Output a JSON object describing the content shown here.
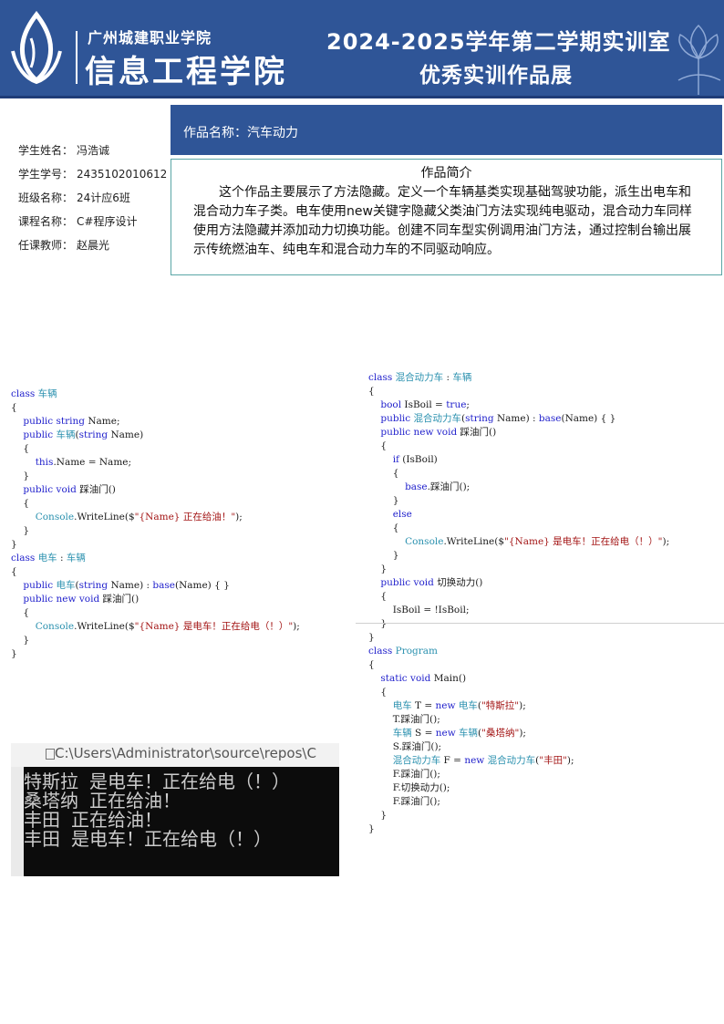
{
  "header": {
    "school_name_small": "广州城建职业学院",
    "school_name_big": "信息工程学院",
    "exhibition_line1": "2024-2025学年第二学期实训室",
    "exhibition_line2": "优秀实训作品展"
  },
  "student_info": [
    {
      "label": "学生姓名：",
      "value": "冯浩诚"
    },
    {
      "label": "学生学号：",
      "value": "2435102010612"
    },
    {
      "label": "班级名称：",
      "value": "24计应6班"
    },
    {
      "label": "课程名称：",
      "value": "C#程序设计"
    },
    {
      "label": "任课教师：",
      "value": "赵晨光"
    }
  ],
  "work": {
    "title": "作品名称：汽车动力",
    "intro_heading": "作品简介",
    "intro_body": "这个作品主要展示了方法隐藏。定义一个车辆基类实现基础驾驶功能，派生出电车和混合动力车子类。电车使用new关键字隐藏父类油门方法实现纯电驱动，混合动力车同样使用方法隐藏并添加动力切换功能。创建不同车型实例调用油门方法，通过控制台输出展示传统燃油车、纯电车和混合动力车的不同驱动响应。"
  },
  "code_left": [
    "class 车辆",
    "{",
    "    public string Name;",
    "    public 车辆(string Name)",
    "    {",
    "        this.Name = Name;",
    "    }",
    "    public void 踩油门()",
    "    {",
    "        Console.WriteLine($\"{Name} 正在给油！\");",
    "    }",
    "}",
    "class 电车 : 车辆",
    "{",
    "    public 电车(string Name) : base(Name) { }",
    "    public new void 踩油门()",
    "    {",
    "        Console.WriteLine($\"{Name} 是电车！正在给电（！）\");",
    "    }",
    "}"
  ],
  "code_right": [
    "class 混合动力车 : 车辆",
    "{",
    "    bool IsBoil = true;",
    "    public 混合动力车(string Name) : base(Name) { }",
    "    public new void 踩油门()",
    "    {",
    "        if (IsBoil)",
    "        {",
    "            base.踩油门();",
    "        }",
    "        else",
    "        {",
    "            Console.WriteLine($\"{Name} 是电车！正在给电（！）\");",
    "        }",
    "    }",
    "    public void 切换动力()",
    "    {",
    "        IsBoil = !IsBoil;",
    "    }",
    "}",
    "class Program",
    "{",
    "    static void Main()",
    "    {",
    "        电车 T = new 电车(\"特斯拉\");",
    "        T.踩油门();",
    "        车辆 S = new 车辆(\"桑塔纳\");",
    "        S.踩油门();",
    "        混合动力车 F = new 混合动力车(\"丰田\");",
    "        F.踩油门();",
    "        F.切换动力();",
    "        F.踩油门();",
    "    }",
    "}"
  ],
  "console": {
    "window_title": "C:\\Users\\Administrator\\source\\repos\\C",
    "output_lines": [
      "特斯拉 是电车！正在给电（！）",
      "桑塔纳 正在给油！",
      "丰田 正在给油！",
      "丰田 是电车！正在给电（！）"
    ]
  },
  "colors": {
    "banner": "#2f5597",
    "keyword": "#2222cc",
    "type": "#2b91af",
    "string": "#a31515"
  }
}
